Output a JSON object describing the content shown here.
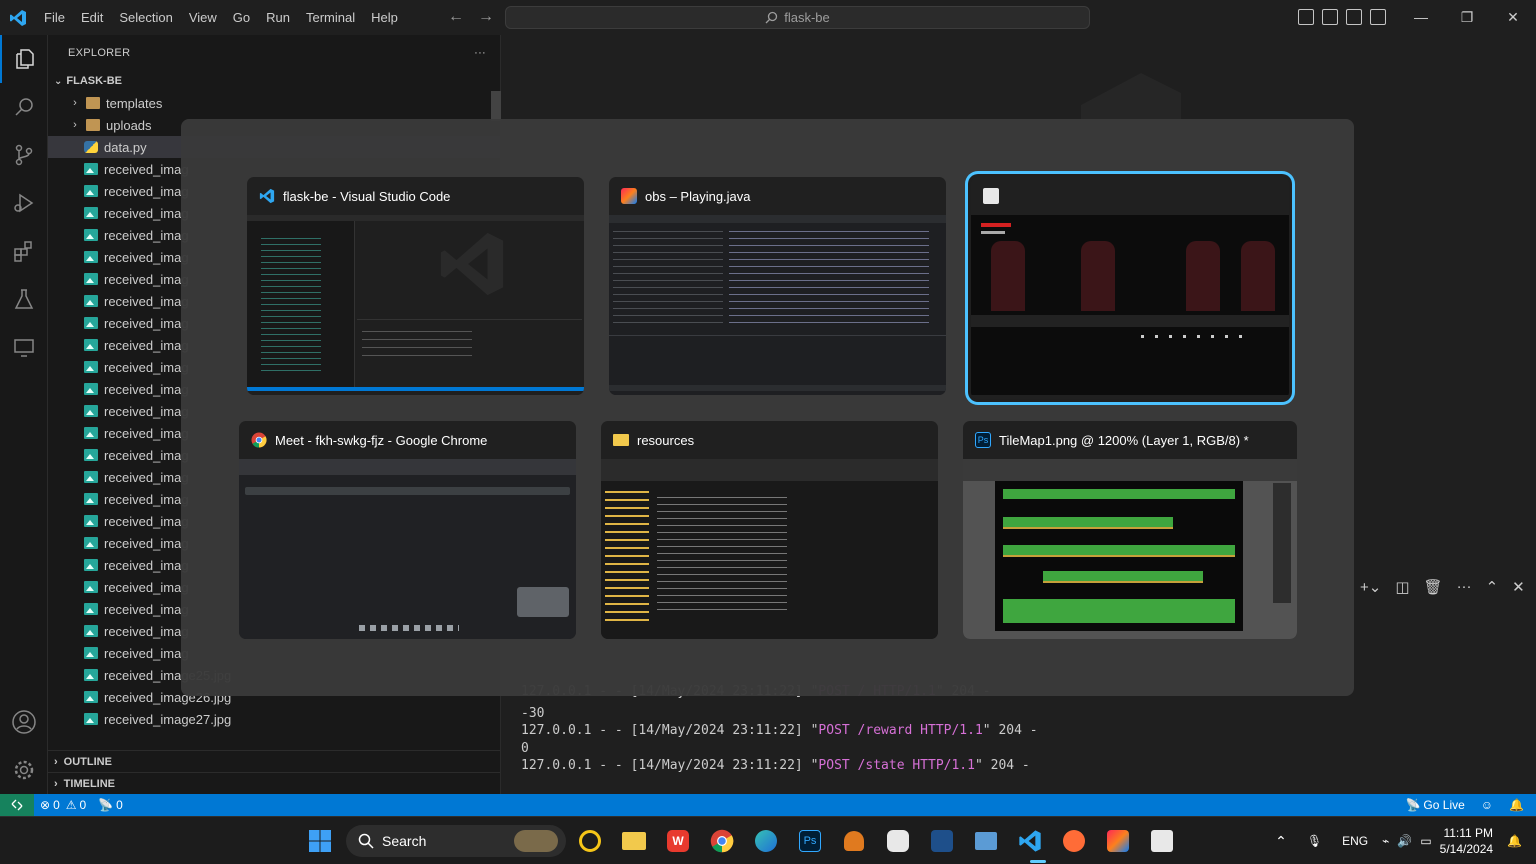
{
  "window": {
    "menu": [
      "File",
      "Edit",
      "Selection",
      "View",
      "Go",
      "Run",
      "Terminal",
      "Help"
    ],
    "search_text": "flask-be"
  },
  "explorer": {
    "header": "EXPLORER",
    "folder": "FLASK-BE",
    "items": [
      {
        "label": "templates",
        "kind": "folder"
      },
      {
        "label": "uploads",
        "kind": "folder"
      },
      {
        "label": "data.py",
        "kind": "python"
      },
      {
        "label": "received_imag",
        "kind": "image"
      },
      {
        "label": "received_imag",
        "kind": "image"
      },
      {
        "label": "received_imag",
        "kind": "image"
      },
      {
        "label": "received_imag",
        "kind": "image"
      },
      {
        "label": "received_imag",
        "kind": "image"
      },
      {
        "label": "received_imag",
        "kind": "image"
      },
      {
        "label": "received_imag",
        "kind": "image"
      },
      {
        "label": "received_imag",
        "kind": "image"
      },
      {
        "label": "received_imag",
        "kind": "image"
      },
      {
        "label": "received_imag",
        "kind": "image"
      },
      {
        "label": "received_imag",
        "kind": "image"
      },
      {
        "label": "received_imag",
        "kind": "image"
      },
      {
        "label": "received_imag",
        "kind": "image"
      },
      {
        "label": "received_imag",
        "kind": "image"
      },
      {
        "label": "received_imag",
        "kind": "image"
      },
      {
        "label": "received_imag",
        "kind": "image"
      },
      {
        "label": "received_imag",
        "kind": "image"
      },
      {
        "label": "received_imag",
        "kind": "image"
      },
      {
        "label": "received_imag",
        "kind": "image"
      },
      {
        "label": "received_imag",
        "kind": "image"
      },
      {
        "label": "received_imag",
        "kind": "image"
      },
      {
        "label": "received_imag",
        "kind": "image"
      },
      {
        "label": "received_imag",
        "kind": "image"
      },
      {
        "label": "received_image25.jpg",
        "kind": "image"
      },
      {
        "label": "received_image26.jpg",
        "kind": "image"
      },
      {
        "label": "received_image27.jpg",
        "kind": "image"
      }
    ],
    "outline": "OUTLINE",
    "timeline": "TIMELINE"
  },
  "terminal": {
    "lines": [
      {
        "pre": "127.0.0.1 - - [14/May/2024 23:11:22] \"",
        "req": "POST / HTTP/1.1",
        "post": "\" 204 -"
      },
      {
        "pre": "-30",
        "req": "",
        "post": ""
      },
      {
        "pre": "127.0.0.1 - - [14/May/2024 23:11:22] \"",
        "req": "POST /reward HTTP/1.1",
        "post": "\" 204 -"
      },
      {
        "pre": "0",
        "req": "",
        "post": ""
      },
      {
        "pre": "127.0.0.1 - - [14/May/2024 23:11:22] \"",
        "req": "POST /state HTTP/1.1",
        "post": "\" 204 -"
      }
    ]
  },
  "status": {
    "errors": "0",
    "warnings": "0",
    "ports": "0",
    "golive": "Go Live"
  },
  "switcher": {
    "windows": [
      {
        "title": "flask-be - Visual Studio Code",
        "icon": "vscode-icon"
      },
      {
        "title": "obs – Playing.java",
        "icon": "intellij-icon"
      },
      {
        "title": "",
        "icon": "java-icon"
      },
      {
        "title": "Meet - fkh-swkg-fjz - Google Chrome",
        "icon": "chrome-icon"
      },
      {
        "title": "resources",
        "icon": "folder-icon"
      },
      {
        "title": "TileMap1.png @ 1200% (Layer 1, RGB/8) *",
        "icon": "photoshop-icon"
      }
    ]
  },
  "taskbar": {
    "search": "Search",
    "lang": "ENG",
    "time": "11:11 PM",
    "date": "5/14/2024"
  }
}
